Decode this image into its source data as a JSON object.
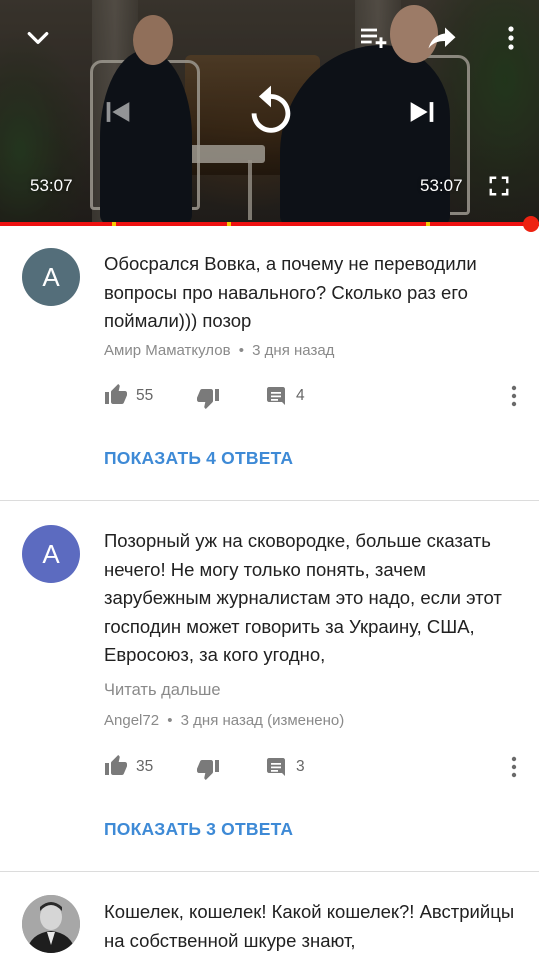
{
  "player": {
    "time_left": "53:07",
    "time_right": "53:07",
    "progress_fraction": 0.985,
    "icons": [
      "chevron-down-icon",
      "add-to-queue-icon",
      "share-icon",
      "more-vert-icon",
      "skip-previous-icon",
      "replay-icon",
      "skip-next-icon",
      "fullscreen-icon"
    ]
  },
  "comments": [
    {
      "avatar_letter": "A",
      "avatar_color": "#546e7a",
      "text": "Обосрался Вовка, а почему не переводили вопросы про навального? Сколько раз его поймали))) позор",
      "author": "Амир Маматкулов",
      "sep": "•",
      "time": "3 дня назад",
      "likes": "55",
      "replies_count": "4",
      "replies_button": "ПОКАЗАТЬ 4 ОТВЕТА"
    },
    {
      "avatar_letter": "A",
      "avatar_color": "#5c6bc0",
      "text": "Позорный уж на сковородке, больше сказать нечего! Не могу только понять, зачем зарубежным журналистам это надо, если этот господин может говорить за Украину, США, Евросоюз, за кого угодно,",
      "read_more": "Читать дальше",
      "author": "Angel72",
      "sep": "•",
      "time": "3 дня назад (изменено)",
      "likes": "35",
      "replies_count": "3",
      "replies_button": "ПОКАЗАТЬ 3 ОТВЕТА"
    },
    {
      "text": "Кошелек, кошелек! Какой кошелек?! Австрийцы на собственной шкуре знают,"
    }
  ],
  "colors": {
    "accent_blue": "#3e8ad6",
    "progress_red": "#e11111",
    "meta_gray": "#8a8a8a"
  }
}
